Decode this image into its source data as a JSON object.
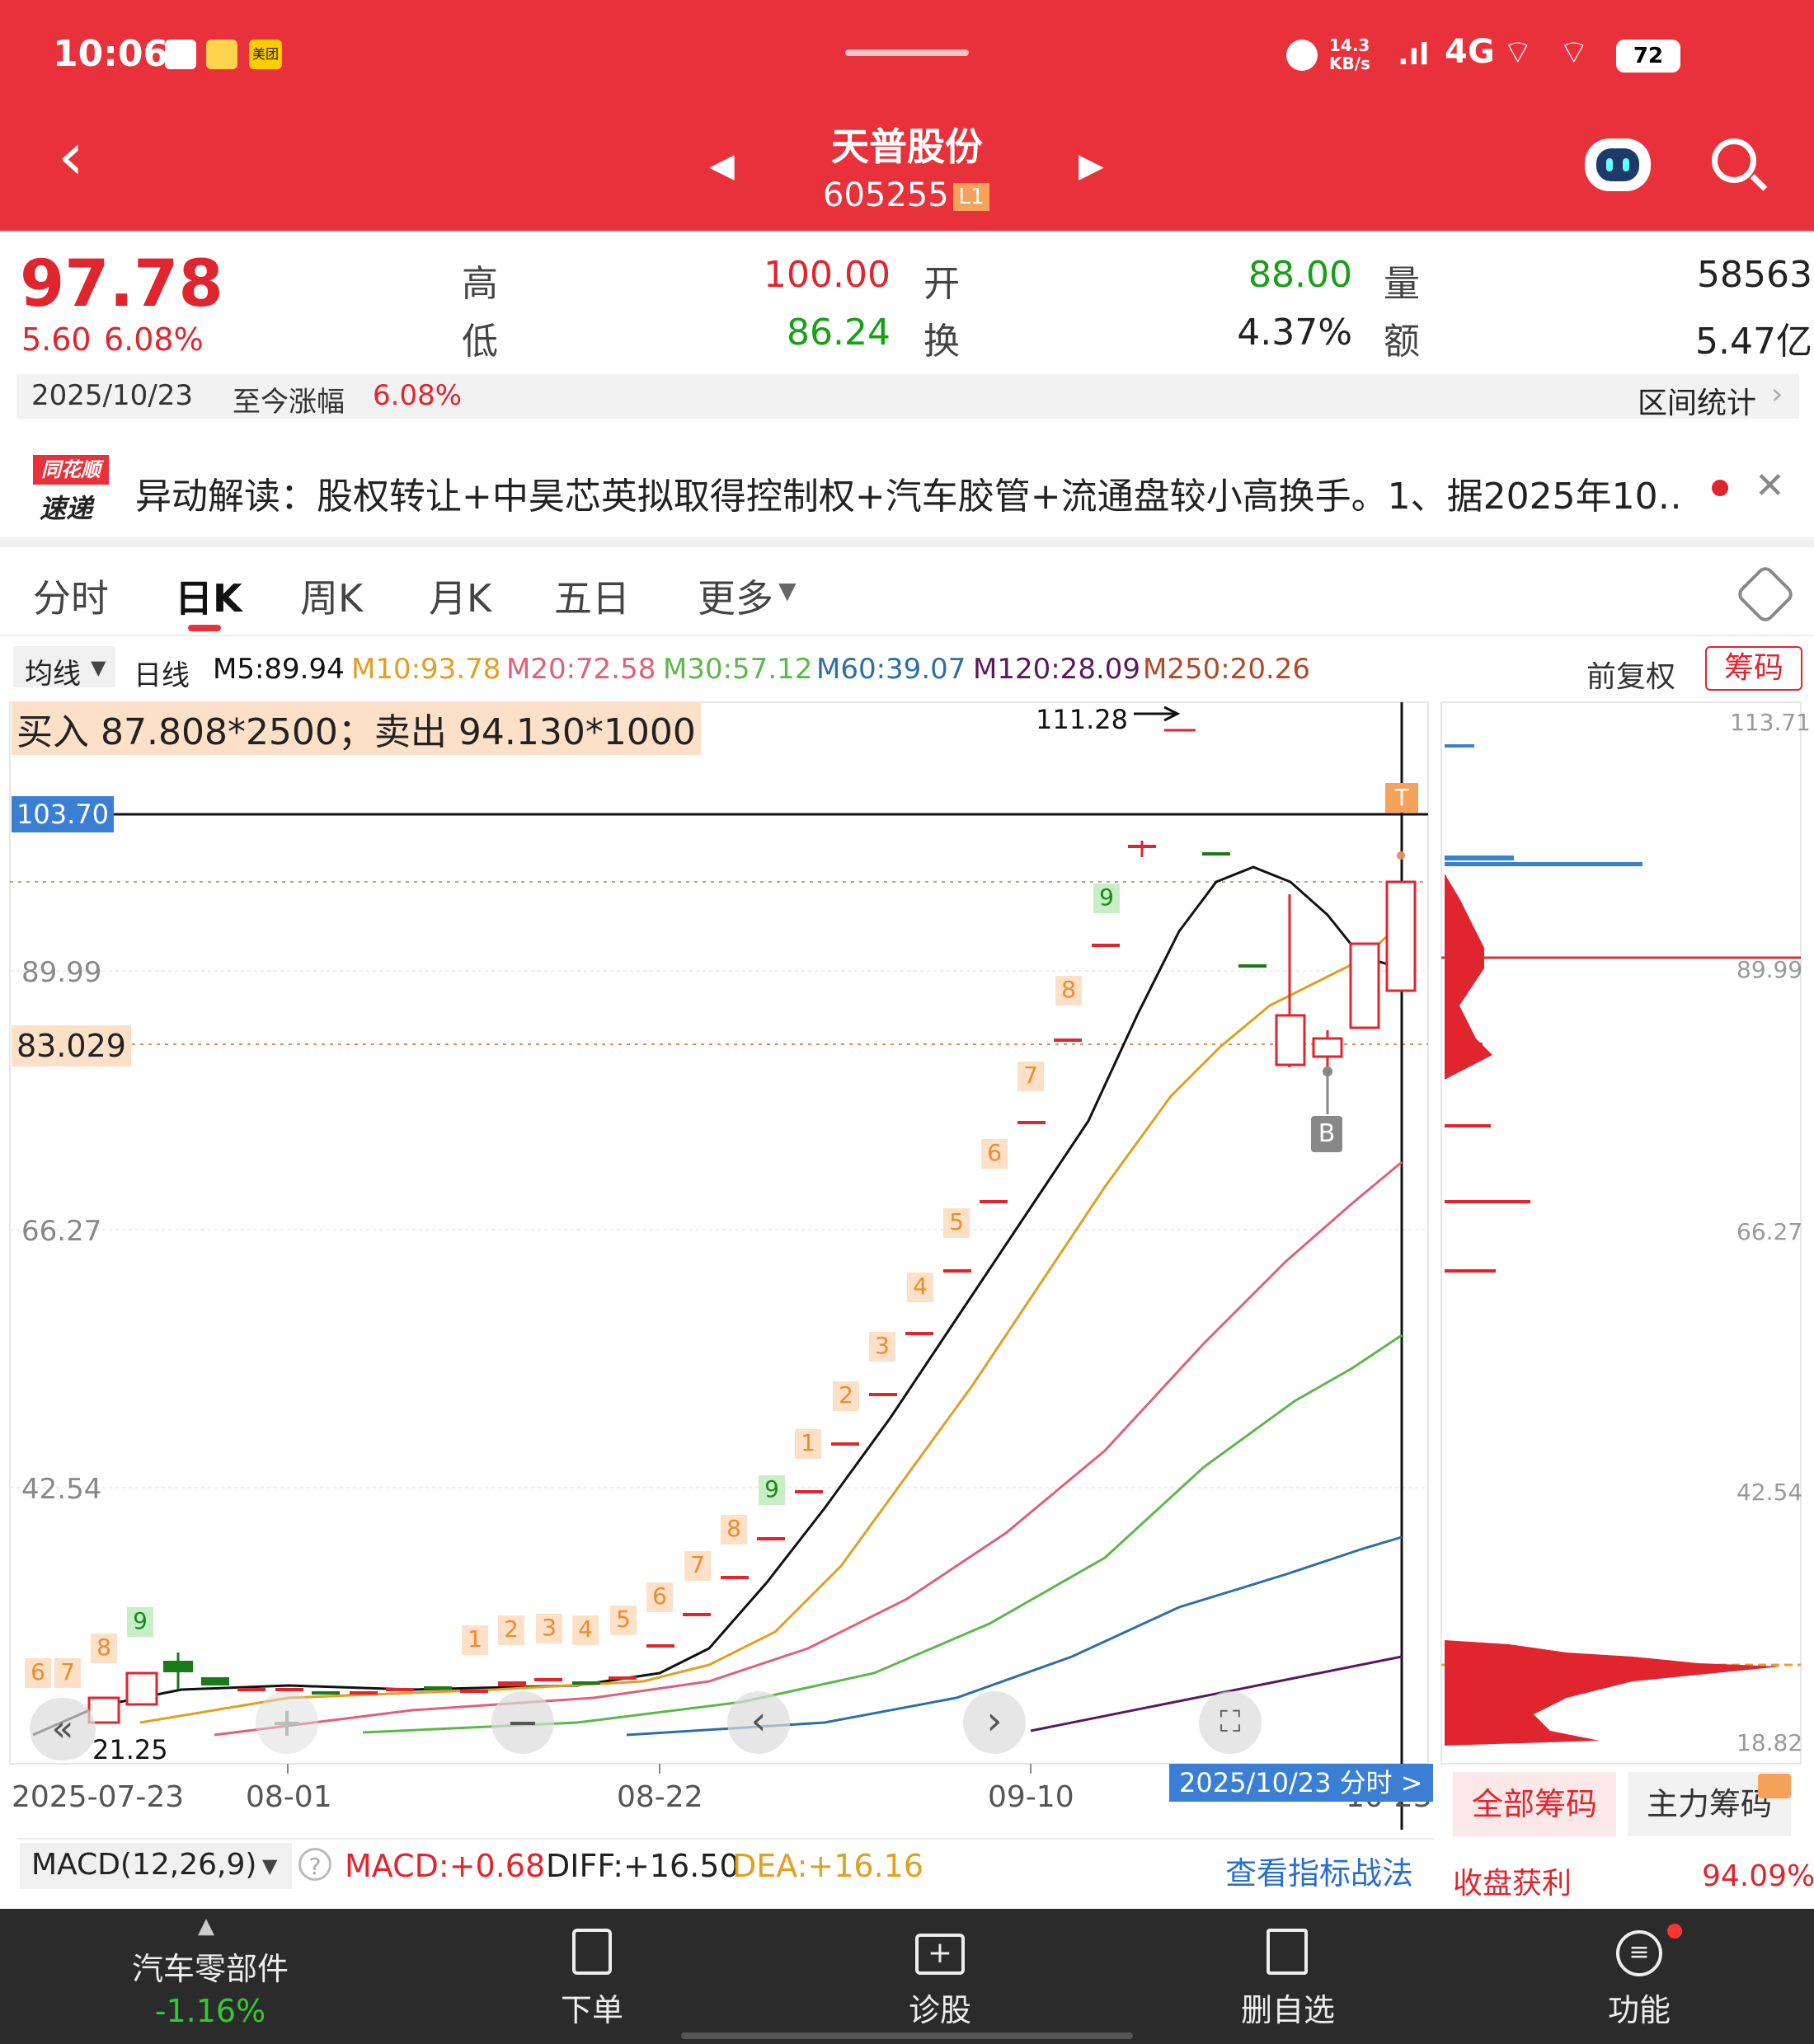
{
  "status": {
    "time": "10:06",
    "speed": "14.3 KB/s",
    "net": "4G",
    "battery": "72",
    "app_badge": "美团"
  },
  "header": {
    "name": "天普股份",
    "code": "605255",
    "level": "L1"
  },
  "quote": {
    "price": "97.78",
    "change": "5.60",
    "change_pct": "6.08%",
    "high_label": "高",
    "high": "100.00",
    "open_label": "开",
    "open": "88.00",
    "volume_label": "量",
    "volume": "58563",
    "low_label": "低",
    "low": "86.24",
    "turnover_label": "换",
    "turnover": "4.37%",
    "amount_label": "额",
    "amount": "5.47亿",
    "date": "2025/10/23",
    "since_label": "至今涨幅",
    "since_pct": "6.08%",
    "interval_stats": "区间统计"
  },
  "news": {
    "logo_top": "同花顺",
    "logo_bottom": "速递",
    "text": "异动解读：股权转让+中昊芯英拟取得控制权+汽车胶管+流通盘较小高换手。1、据2025年10…"
  },
  "tabs": [
    "分时",
    "日K",
    "周K",
    "月K",
    "五日",
    "更多"
  ],
  "ma": {
    "selector": "均线",
    "period": "日线",
    "m5": "M5:89.94",
    "m10": "M10:93.78",
    "m20": "M20:72.58",
    "m30": "M30:57.12",
    "m60": "M60:39.07",
    "m120": "M120:28.09",
    "m250": "M250:20.26",
    "adjust": "前复权",
    "chips_btn": "筹码"
  },
  "chart": {
    "trade_note": "买入 87.808*2500；卖出 94.130*1000",
    "high_mark": "111.28",
    "line_label": "103.70",
    "cost_label": "83.029",
    "y_labels": [
      "89.99",
      "66.27",
      "42.54",
      "21.25"
    ],
    "x_labels": [
      "2025-07-23",
      "08-01",
      "08-22",
      "09-10",
      "10-23"
    ],
    "cursor_tip": "2025/10/23 分时 >",
    "b_marker": "B",
    "chip_labels": [
      "113.71",
      "89.99",
      "66.27",
      "42.54",
      "18.82"
    ],
    "sequence_numbers_top": [
      "1",
      "2",
      "3",
      "4",
      "5",
      "6",
      "7",
      "8",
      "9"
    ],
    "sequence_numbers_bottom": [
      "6",
      "7",
      "8",
      "9",
      "1",
      "2",
      "3",
      "4",
      "5",
      "6",
      "7",
      "8",
      "9"
    ]
  },
  "chips": {
    "all": "全部筹码",
    "main": "主力筹码",
    "profit_label": "收盘获利",
    "profit": "94.09%"
  },
  "macd": {
    "name": "MACD(12,26,9)",
    "macd": "MACD:+0.68",
    "diff": "DIFF:+16.50",
    "dea": "DEA:+16.16",
    "link": "查看指标战法"
  },
  "bottom": {
    "sector": "汽车零部件",
    "sector_pct": "-1.16%",
    "order": "下单",
    "diagnose": "诊股",
    "remove": "删自选",
    "func": "功能"
  },
  "colors": {
    "brand": "#e8313b",
    "up": "#e0252f",
    "down": "#16a016"
  }
}
